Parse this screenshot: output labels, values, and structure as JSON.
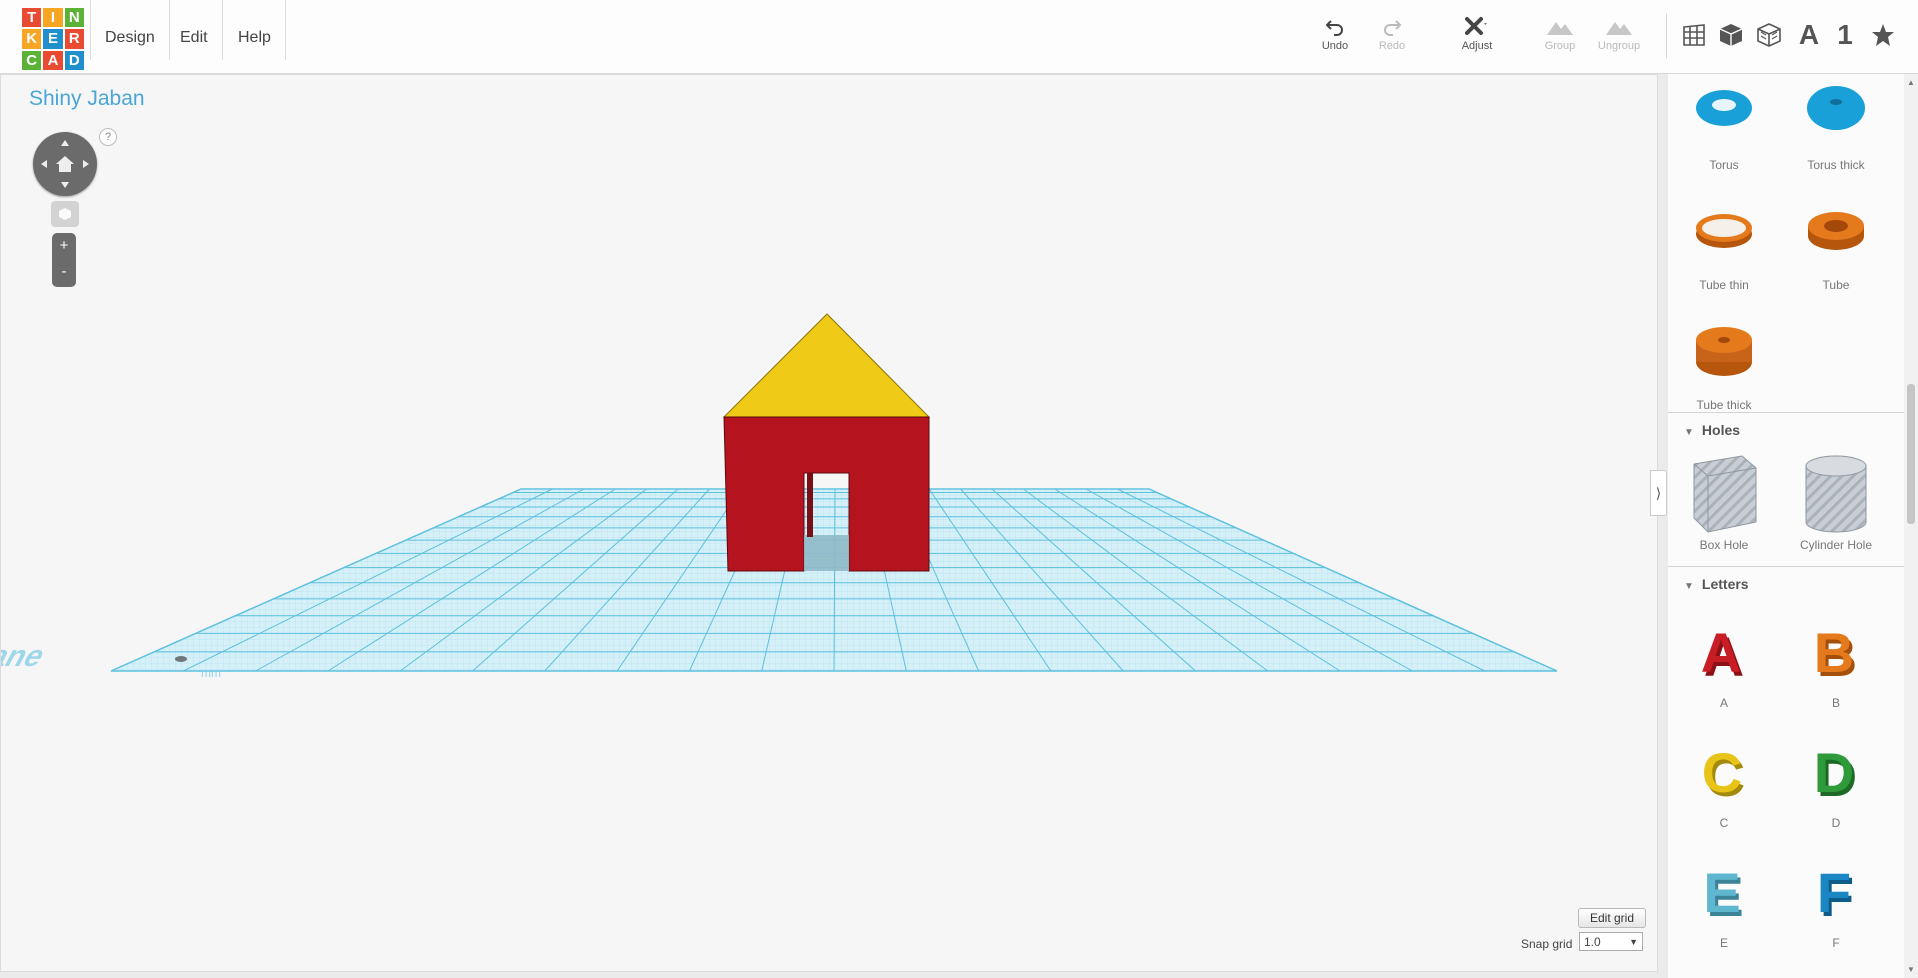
{
  "logo": {
    "letters": [
      "T",
      "I",
      "N",
      "K",
      "E",
      "R",
      "C",
      "A",
      "D"
    ],
    "colors": [
      "#e94a32",
      "#f6a623",
      "#5bb236",
      "#f6a623",
      "#1f8fce",
      "#e94a32",
      "#5bb236",
      "#e94a32",
      "#1f8fce"
    ]
  },
  "menu": {
    "design": "Design",
    "edit": "Edit",
    "help": "Help"
  },
  "toolbar": {
    "undo": "Undo",
    "redo": "Redo",
    "adjust": "Adjust",
    "group": "Group",
    "ungroup": "Ungroup"
  },
  "view_tools": {
    "letter": "A",
    "number": "1"
  },
  "workspace": {
    "title": "Shiny Jaban",
    "help": "?",
    "zoom_in": "+",
    "zoom_out": "-",
    "workplane_text": "Workplane",
    "workplane_unit": "mm",
    "edit_grid": "Edit grid",
    "snap_label": "Snap grid",
    "snap_value": "1.0"
  },
  "colors": {
    "accent": "#4aa5d8",
    "grid": "#5cc0df",
    "wall": "#b5141f",
    "roof": "#efcb17",
    "orange": "#e57a1c",
    "blue": "#1aa0d8",
    "hole": "#b9bfc6"
  },
  "panel": {
    "shapes": [
      {
        "label": "Torus"
      },
      {
        "label": "Torus thick"
      },
      {
        "label": "Tube thin"
      },
      {
        "label": "Tube"
      },
      {
        "label": "Tube thick"
      }
    ],
    "holes_header": "Holes",
    "holes": [
      {
        "label": "Box Hole"
      },
      {
        "label": "Cylinder Hole"
      }
    ],
    "letters_header": "Letters",
    "letters": [
      {
        "label": "A",
        "color": "#c81d25"
      },
      {
        "label": "B",
        "color": "#e57a1c"
      },
      {
        "label": "C",
        "color": "#e8c419"
      },
      {
        "label": "D",
        "color": "#2f9a3a"
      },
      {
        "label": "E",
        "color": "#5fb7cf"
      },
      {
        "label": "F",
        "color": "#1a86c4"
      }
    ]
  }
}
